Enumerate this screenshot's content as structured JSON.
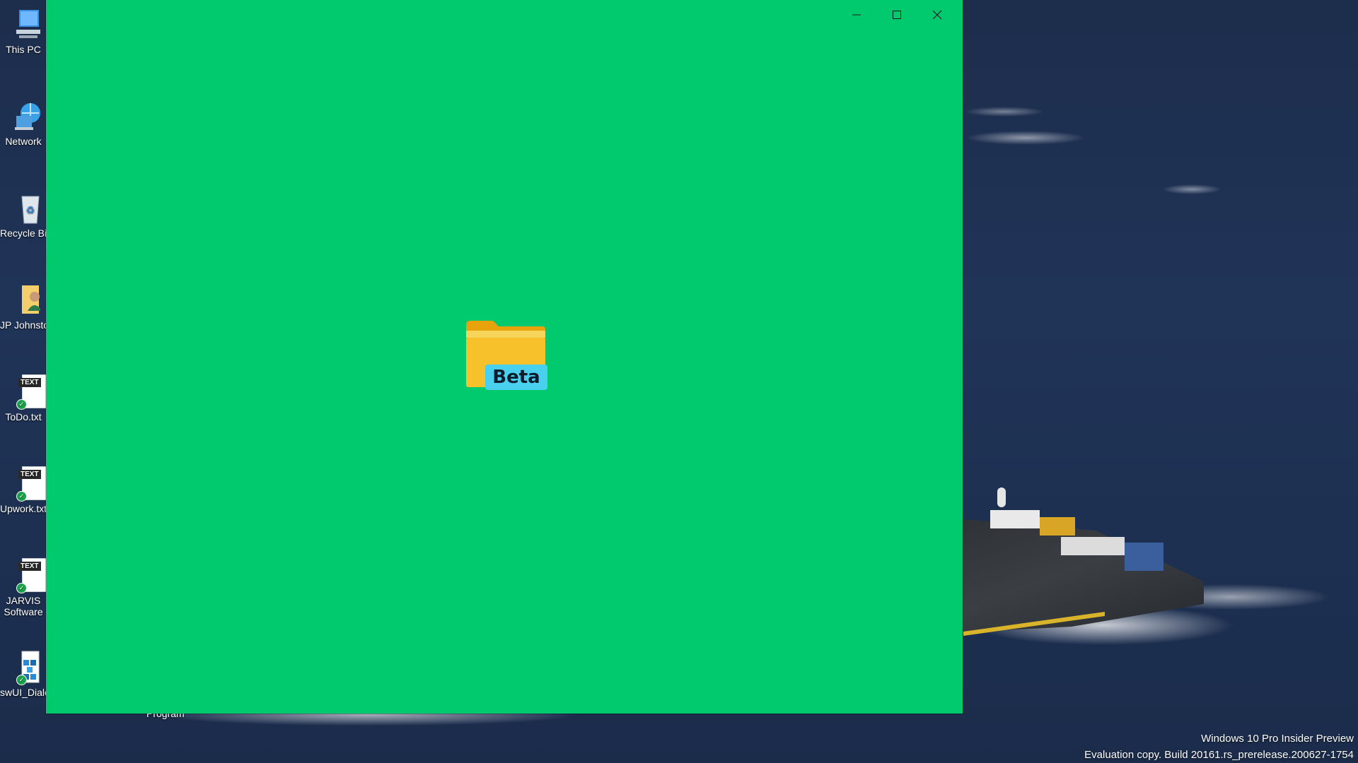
{
  "desktop": {
    "icons": [
      {
        "label": "This PC",
        "icon": "computer-icon"
      },
      {
        "label": "Network",
        "icon": "network-icon"
      },
      {
        "label": "Recycle Bin",
        "icon": "recycle-bin-icon"
      },
      {
        "label": "JP Johnston",
        "icon": "user-folder-icon"
      },
      {
        "label": "ToDo.txt",
        "icon": "text-file-icon",
        "tag": "TEXT"
      },
      {
        "label": "Upwork.txt",
        "icon": "text-file-icon",
        "tag": "TEXT"
      },
      {
        "label": "JARVIS Software",
        "icon": "text-file-icon",
        "tag": "TEXT"
      },
      {
        "label": "swUI_Dialog",
        "icon": "cubes-file-icon"
      }
    ],
    "stray_label": "Program"
  },
  "watermark": {
    "line1": "Windows 10 Pro Insider Preview",
    "line2": "Evaluation copy. Build 20161.rs_prerelease.200627-1754"
  },
  "window": {
    "background": "#00c96e",
    "caption": {
      "minimize_icon": "minimize-icon",
      "maximize_icon": "maximize-icon",
      "close_icon": "close-icon"
    },
    "splash": {
      "icon": "folder-icon",
      "badge_text": "Beta",
      "badge_color": "#49d0ef"
    }
  }
}
